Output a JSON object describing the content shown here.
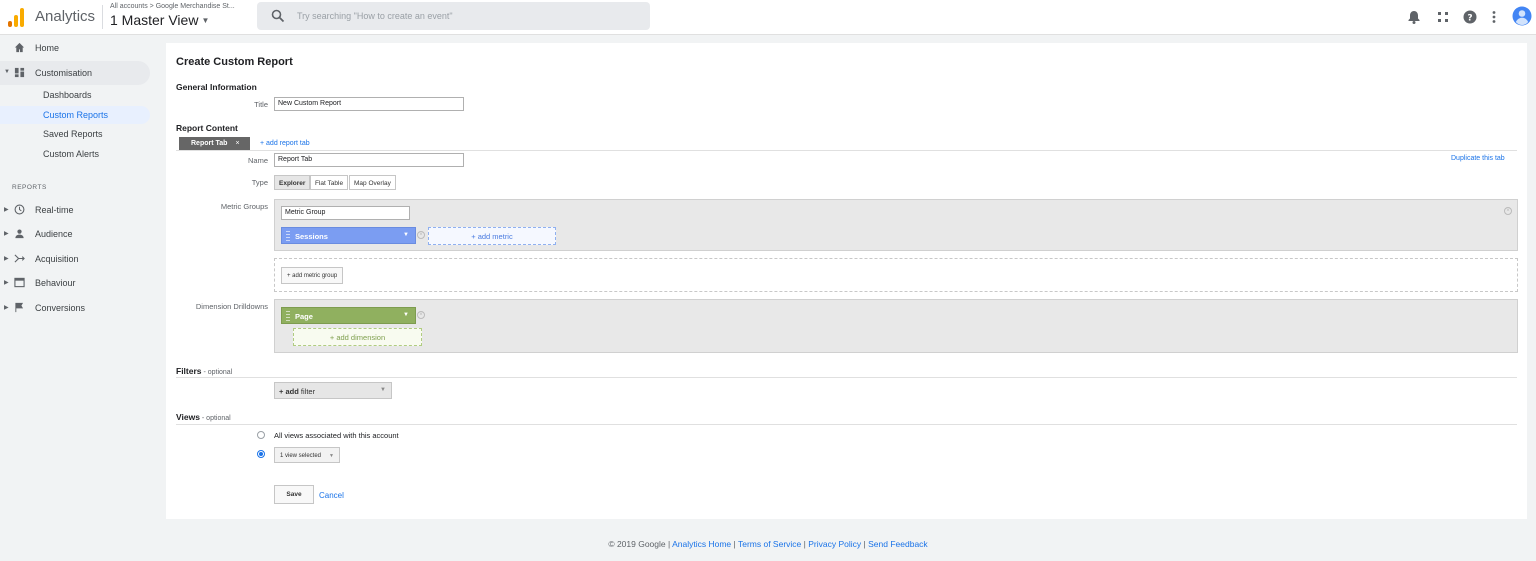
{
  "header": {
    "app_title": "Analytics",
    "account_breadcrumb": "All accounts > Google Merchandise St...",
    "view_name": "1 Master View",
    "search_placeholder": "Try searching \"How to create an event\""
  },
  "sidebar": {
    "home": "Home",
    "customisation": "Customisation",
    "sub_items": [
      "Dashboards",
      "Custom Reports",
      "Saved Reports",
      "Custom Alerts"
    ],
    "reports_heading": "REPORTS",
    "reports": [
      "Real-time",
      "Audience",
      "Acquisition",
      "Behaviour",
      "Conversions"
    ]
  },
  "form": {
    "page_title": "Create Custom Report",
    "general_heading": "General Information",
    "title_label": "Title",
    "title_value": "New Custom Report",
    "content_heading": "Report Content",
    "tab_name": "Report Tab",
    "tab_close": "×",
    "add_tab": "+ add report tab",
    "duplicate_tab": "Duplicate this tab",
    "name_label": "Name",
    "name_value": "Report Tab",
    "type_label": "Type",
    "types": [
      "Explorer",
      "Flat Table",
      "Map Overlay"
    ],
    "metric_groups_label": "Metric Groups",
    "metric_group_name": "Metric Group",
    "metric": "Sessions",
    "add_metric": "+ add metric",
    "add_metric_group": "+ add metric group",
    "dimension_label": "Dimension Drilldowns",
    "dimension": "Page",
    "add_dimension": "+ add dimension",
    "filters_heading": "Filters",
    "filters_optional": " - optional",
    "add_filter_plus": "+ add",
    "add_filter_word": " filter",
    "views_heading": "Views",
    "views_optional": " - optional",
    "view_option_all": "All views associated with this account",
    "view_selected": "1 view selected",
    "save": "Save",
    "cancel": "Cancel"
  },
  "footer": {
    "copyright": "© 2019 Google |",
    "links": [
      "Analytics Home",
      "Terms of Service",
      "Privacy Policy",
      "Send Feedback"
    ],
    "separator": "|"
  },
  "colors": {
    "accent": "#1a73e8",
    "metric_pill": "#7b9df2",
    "dimension_pill": "#90b05f",
    "logo_orange": "#f9ab00",
    "logo_dark": "#e37400"
  }
}
